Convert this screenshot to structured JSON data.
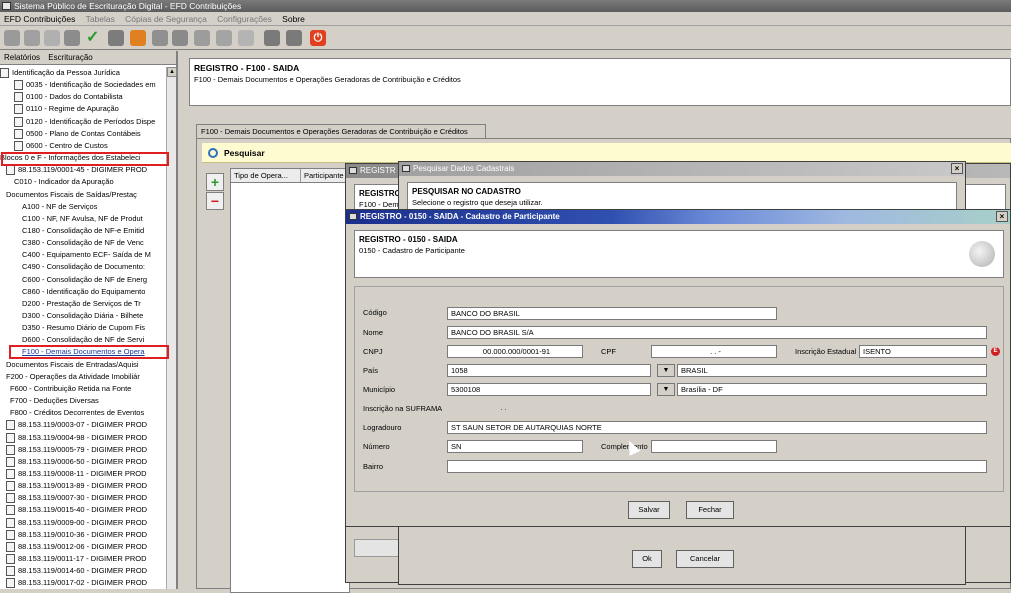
{
  "window": {
    "title": "Sistema Público de Escrituração Digital - EFD Contribuições"
  },
  "menu": [
    "EFD Contribuições",
    "Tabelas",
    "Cópias de Segurança",
    "Configurações",
    "Sobre"
  ],
  "left_tabs": [
    "Relatórios",
    "Escrituração"
  ],
  "tree": [
    "Identificação da Pessoa Jurídica",
    "0035 - Identificação de Sociedades em",
    "0100 - Dados do Contabilista",
    "0110 - Regime de Apuração",
    "0120 - Identificação de Períodos Dispe",
    "0500 - Plano de Contas Contábeis",
    "0600 - Centro de Custos",
    "Blocos 0 e F - Informações dos Estabeleci",
    "88.153.119/0001-45 - DIGIMER PROD",
    "C010 - Indicador da Apuração",
    "Documentos Fiscais de Saídas/Prestaç",
    "A100 - NF de Serviços",
    "C100 - NF, NF Avulsa, NF de Produt",
    "C180 - Consolidação de NF-e Emitid",
    "C380 - Consolidação de NF de Venc",
    "C400 - Equipamento ECF- Saída de M",
    "C490 - Consolidação de Documento:",
    "C600 - Consolidação de NF de Energ",
    "C860 - Identificação do Equipamento",
    "D200 - Prestação de Serviços de Tr",
    "D300 - Consolidação Diária - Bilhete",
    "D350 - Resumo Diário de Cupom Fis",
    "D600 - Consolidação de NF de Servi",
    "F100 - Demais Documentos e Opera",
    "Documentos Fiscais de Entradas/Aquisi",
    "F200 - Operações da Atividade Imobiliár",
    "F600 - Contribuição Retida na Fonte",
    "F700 - Deduções Diversas",
    "F800 - Créditos Decorrentes de Eventos",
    "88.153.119/0003-07 - DIGIMER PROD",
    "88.153.119/0004-98 - DIGIMER PROD",
    "88.153.119/0005-79 - DIGIMER PROD",
    "88.153.119/0006-50 - DIGIMER PROD",
    "88.153.119/0008-11 - DIGIMER PROD",
    "88.153.119/0013-89 - DIGIMER PROD",
    "88.153.119/0007-30 - DIGIMER PROD",
    "88.153.119/0015-40 - DIGIMER PROD",
    "88.153.119/0009-00 - DIGIMER PROD",
    "88.153.119/0010-36 - DIGIMER PROD",
    "88.153.119/0012-06 - DIGIMER PROD",
    "88.153.119/0011-17 - DIGIMER PROD",
    "88.153.119/0014-60 - DIGIMER PROD",
    "88.153.119/0017-02 - DIGIMER PROD"
  ],
  "header": {
    "title": "REGISTRO - F100 - SAIDA",
    "subtitle": "F100 - Demais Documentos e Operações Geradoras de Contribuição e Créditos"
  },
  "tab": {
    "label": "F100 - Demais Documentos e Operações Geradoras de Contribuição e Créditos"
  },
  "search": {
    "label": "Pesquisar"
  },
  "grid": {
    "columns": [
      "Tipo de Opera...",
      "Participante"
    ]
  },
  "dlg_behind": {
    "title": "REGISTR",
    "body": "REGISTRO",
    "body2": "F100 - Dem"
  },
  "dlg_search": {
    "title": "Pesquisar Dados Cadastrais",
    "heading": "PESQUISAR NO CADASTRO",
    "text": "Selecione o registro que deseja utilizar.",
    "ok": "Ok",
    "cancel": "Cancelar"
  },
  "dlg_participant": {
    "title": "REGISTRO - 0150 - SAIDA - Cadastro de Participante",
    "heading": "REGISTRO - 0150 - SAIDA",
    "subheading": "0150 - Cadastro de Participante",
    "fields": {
      "codigo_label": "Código",
      "codigo": "BANCO DO BRASIL",
      "nome_label": "Nome",
      "nome": "BANCO DO BRASIL S/A",
      "cnpj_label": "CNPJ",
      "cnpj": "00.000.000/0001-91",
      "cpf_label": "CPF",
      "cpf": ". . -",
      "ie_label": "Inscrição Estadual",
      "ie": "ISENTO",
      "pais_label": "País",
      "pais_code": "1058",
      "pais_name": "BRASIL",
      "municipio_label": "Município",
      "municipio_code": "5300108",
      "municipio_name": "Brasília - DF",
      "suframa_label": "Inscrição na SUFRAMA",
      "suframa": ". .",
      "logradouro_label": "Logradouro",
      "logradouro": "ST SAUN SETOR DE AUTARQUIAS NORTE",
      "numero_label": "Número",
      "numero": "SN",
      "complemento_label": "Complemento",
      "complemento": "",
      "bairro_label": "Bairro",
      "bairro": ""
    },
    "save": "Salvar",
    "close": "Fechar"
  },
  "colors": {
    "title_gradient_start": "#1b2f8c",
    "highlight_red": "#e02020",
    "search_bg": "#fffbd0"
  }
}
